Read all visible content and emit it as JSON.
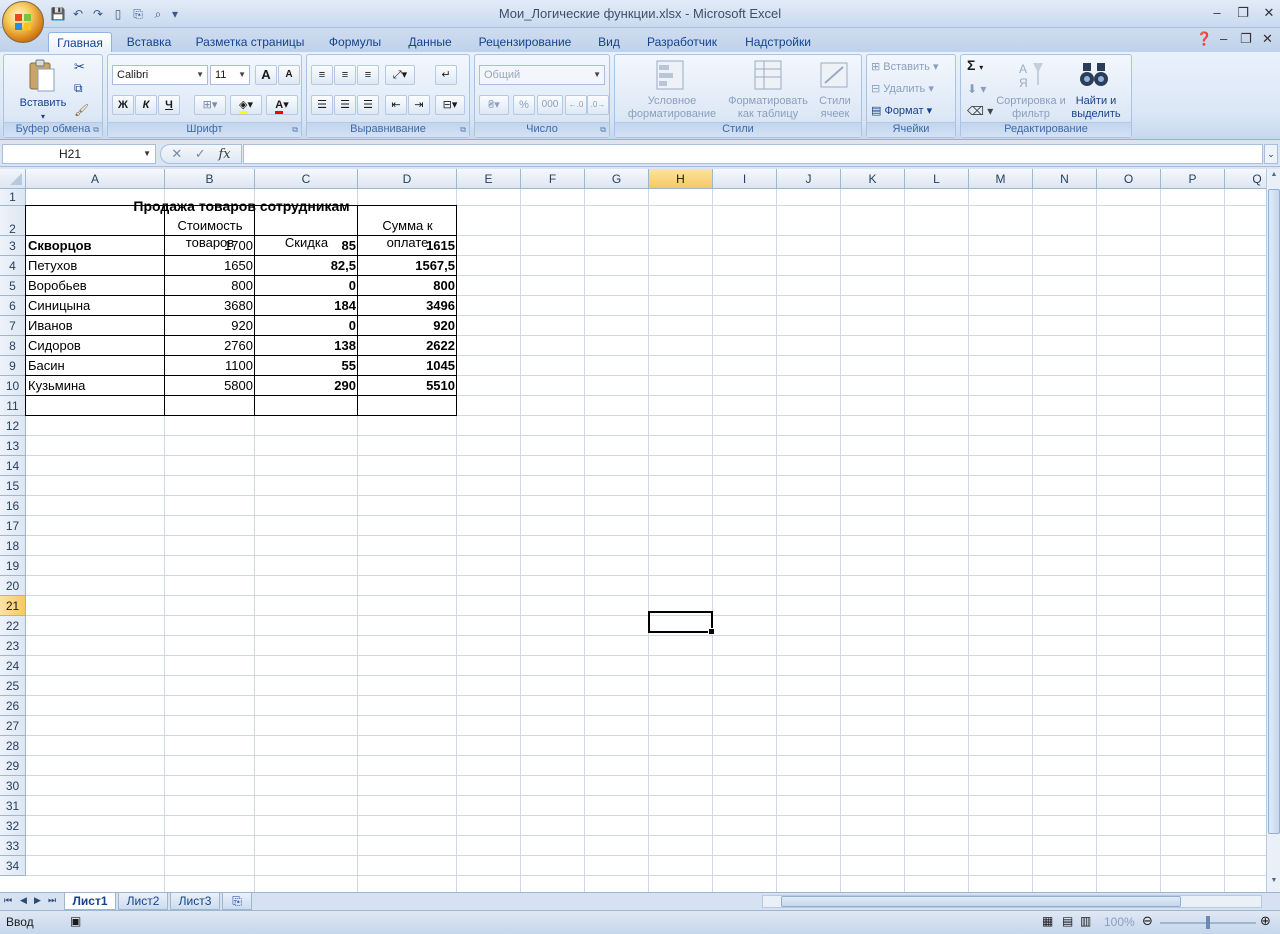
{
  "window": {
    "title": "Мои_Логические функции.xlsx - Microsoft Excel",
    "minimize": "–",
    "restore": "❐",
    "close": "✕"
  },
  "ribbon_tabs": [
    {
      "label": "Главная",
      "active": true
    },
    {
      "label": "Вставка"
    },
    {
      "label": "Разметка страницы"
    },
    {
      "label": "Формулы"
    },
    {
      "label": "Данные"
    },
    {
      "label": "Рецензирование"
    },
    {
      "label": "Вид"
    },
    {
      "label": "Разработчик"
    },
    {
      "label": "Надстройки"
    }
  ],
  "ribbon": {
    "clipboard": {
      "label": "Буфер обмена",
      "paste": "Вставить"
    },
    "font": {
      "label": "Шрифт",
      "name": "Calibri",
      "size": "11",
      "bold": "Ж",
      "italic": "К",
      "underline": "Ч",
      "grow": "A",
      "shrink": "A"
    },
    "alignment": {
      "label": "Выравнивание"
    },
    "number": {
      "label": "Число",
      "format": "Общий",
      "percent": "%",
      "thousands": "000"
    },
    "styles": {
      "label": "Стили",
      "conditional": "Условное форматирование",
      "as_table": "Форматировать как таблицу",
      "cell_styles": "Стили ячеек"
    },
    "cells": {
      "label": "Ячейки",
      "insert": "Вставить",
      "delete": "Удалить",
      "format": "Формат"
    },
    "editing": {
      "label": "Редактирование",
      "sort": "Сортировка и фильтр",
      "find": "Найти и выделить",
      "sum": "Σ"
    }
  },
  "formula_bar": {
    "name_box": "H21",
    "formula": "",
    "fx": "fx"
  },
  "columns": [
    "A",
    "B",
    "C",
    "D",
    "E",
    "F",
    "G",
    "H",
    "I",
    "J",
    "K",
    "L",
    "M",
    "N",
    "O",
    "P",
    "Q"
  ],
  "selected_column": "H",
  "rows": [
    "1",
    "2",
    "3",
    "4",
    "5",
    "6",
    "7",
    "8",
    "9",
    "10",
    "11",
    "12",
    "13",
    "14",
    "15",
    "16",
    "17",
    "18",
    "19",
    "20",
    "21",
    "22",
    "23",
    "24",
    "25",
    "26",
    "27",
    "28",
    "29",
    "30",
    "31",
    "32",
    "33",
    "34"
  ],
  "selected_row": "21",
  "sheet": {
    "title": "Продажа товаров сотрудникам",
    "headers": {
      "cost_line1": "Стоимость",
      "cost_line2": "товаров",
      "discount": "Скидка",
      "total_line1": "Сумма к",
      "total_line2": "оплате"
    },
    "data": [
      {
        "name": "Скворцов",
        "cost": "1700",
        "discount": "85",
        "total": "1615",
        "bold_name": true
      },
      {
        "name": "Петухов",
        "cost": "1650",
        "discount": "82,5",
        "total": "1567,5"
      },
      {
        "name": "Воробьев",
        "cost": "800",
        "discount": "0",
        "total": "800"
      },
      {
        "name": "Синицына",
        "cost": "3680",
        "discount": "184",
        "total": "3496"
      },
      {
        "name": "Иванов",
        "cost": "920",
        "discount": "0",
        "total": "920"
      },
      {
        "name": "Сидоров",
        "cost": "2760",
        "discount": "138",
        "total": "2622"
      },
      {
        "name": "Басин",
        "cost": "1100",
        "discount": "55",
        "total": "1045"
      },
      {
        "name": "Кузьмина",
        "cost": "5800",
        "discount": "290",
        "total": "5510"
      }
    ]
  },
  "sheet_tabs": [
    {
      "label": "Лист1",
      "active": true
    },
    {
      "label": "Лист2"
    },
    {
      "label": "Лист3"
    }
  ],
  "status": {
    "mode": "Ввод",
    "zoom": "100%"
  }
}
